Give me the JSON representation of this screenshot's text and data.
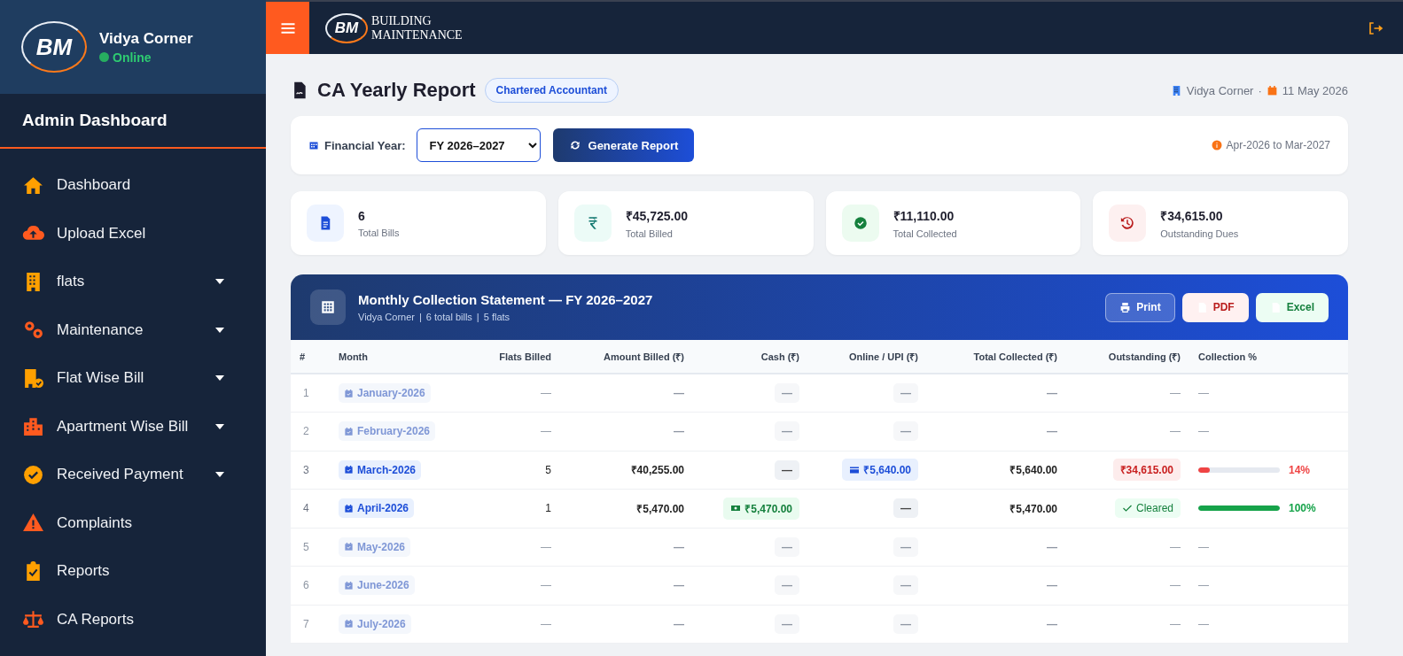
{
  "sidebar": {
    "logo": "BM",
    "user_name": "Vidya Corner",
    "status": "Online",
    "online": true,
    "section_title": "Admin Dashboard",
    "items": [
      {
        "label": "Dashboard",
        "kind": "home",
        "has_submenu": false
      },
      {
        "label": "Upload Excel",
        "kind": "upload",
        "has_submenu": false
      },
      {
        "label": "flats",
        "kind": "building",
        "has_submenu": true
      },
      {
        "label": "Maintenance",
        "kind": "gears",
        "has_submenu": true
      },
      {
        "label": "Flat Wise Bill",
        "kind": "bill",
        "has_submenu": true
      },
      {
        "label": "Apartment Wise Bill",
        "kind": "city",
        "has_submenu": true
      },
      {
        "label": "Received Payment",
        "kind": "payment",
        "has_submenu": true
      },
      {
        "label": "Complaints",
        "kind": "warning",
        "has_submenu": false
      },
      {
        "label": "Reports",
        "kind": "reports",
        "has_submenu": false
      },
      {
        "label": "CA Reports",
        "kind": "scale",
        "has_submenu": false
      }
    ]
  },
  "topbar": {
    "logo": "BM",
    "brand_line_1": "BUILDING",
    "brand_line_2": "MAINTENANCE"
  },
  "page": {
    "title": "CA Yearly Report",
    "badge": "Chartered Accountant",
    "building": "Vidya Corner",
    "separator": "·",
    "date": "11 May 2026"
  },
  "filter": {
    "label": "Financial Year:",
    "value": "FY 2026–2027",
    "button": "Generate Report",
    "range": "Apr-2026 to Mar-2027"
  },
  "stats": [
    {
      "kind": "bills",
      "value": "6",
      "label": "Total Bills"
    },
    {
      "kind": "billed",
      "value": "₹45,725.00",
      "label": "Total Billed"
    },
    {
      "kind": "collected",
      "value": "₹11,110.00",
      "label": "Total Collected"
    },
    {
      "kind": "dues",
      "value": "₹34,615.00",
      "label": "Outstanding Dues"
    }
  ],
  "statement": {
    "title": "Monthly Collection Statement — FY 2026–2027",
    "meta": [
      "Vidya Corner",
      "6 total bills",
      "5 flats"
    ],
    "meta_separator": "|",
    "buttons": [
      {
        "kind": "print",
        "label": "Print"
      },
      {
        "kind": "pdf",
        "label": "PDF"
      },
      {
        "kind": "excel",
        "label": "Excel"
      }
    ]
  },
  "table": {
    "columns": [
      "#",
      "Month",
      "Flats Billed",
      "Amount Billed (₹)",
      "Cash (₹)",
      "Online / UPI (₹)",
      "Total Collected (₹)",
      "Outstanding (₹)",
      "Collection %"
    ],
    "rows": [
      {
        "index": "1",
        "month": "January-2026",
        "active": false,
        "flats": "—",
        "billed": "—",
        "cash": {
          "kind": "none",
          "text": "—"
        },
        "online": {
          "kind": "none",
          "text": "—"
        },
        "collected": "—",
        "outstanding": {
          "kind": "none",
          "text": "—"
        },
        "collection": {
          "kind": "none",
          "text": "—"
        }
      },
      {
        "index": "2",
        "month": "February-2026",
        "active": false,
        "flats": "—",
        "billed": "—",
        "cash": {
          "kind": "none",
          "text": "—"
        },
        "online": {
          "kind": "none",
          "text": "—"
        },
        "collected": "—",
        "outstanding": {
          "kind": "none",
          "text": "—"
        },
        "collection": {
          "kind": "none",
          "text": "—"
        }
      },
      {
        "index": "3",
        "month": "March-2026",
        "active": true,
        "flats": "5",
        "billed": "₹40,255.00",
        "cash": {
          "kind": "none",
          "text": "—"
        },
        "online": {
          "kind": "online",
          "text": "₹5,640.00"
        },
        "collected": "₹5,640.00",
        "outstanding": {
          "kind": "due",
          "text": "₹34,615.00"
        },
        "collection": {
          "kind": "partial",
          "level": 0.14,
          "reading": "14%"
        }
      },
      {
        "index": "4",
        "month": "April-2026",
        "active": true,
        "flats": "1",
        "billed": "₹5,470.00",
        "cash": {
          "kind": "cash",
          "text": "₹5,470.00"
        },
        "online": {
          "kind": "none",
          "text": "—"
        },
        "collected": "₹5,470.00",
        "outstanding": {
          "kind": "cleared",
          "text": "Cleared"
        },
        "collection": {
          "kind": "full",
          "level": 1,
          "reading": "100%"
        }
      },
      {
        "index": "5",
        "month": "May-2026",
        "active": false,
        "flats": "—",
        "billed": "—",
        "cash": {
          "kind": "none",
          "text": "—"
        },
        "online": {
          "kind": "none",
          "text": "—"
        },
        "collected": "—",
        "outstanding": {
          "kind": "none",
          "text": "—"
        },
        "collection": {
          "kind": "none",
          "text": "—"
        }
      },
      {
        "index": "6",
        "month": "June-2026",
        "active": false,
        "flats": "—",
        "billed": "—",
        "cash": {
          "kind": "none",
          "text": "—"
        },
        "online": {
          "kind": "none",
          "text": "—"
        },
        "collected": "—",
        "outstanding": {
          "kind": "none",
          "text": "—"
        },
        "collection": {
          "kind": "none",
          "text": "—"
        }
      },
      {
        "index": "7",
        "month": "July-2026",
        "active": false,
        "flats": "—",
        "billed": "—",
        "cash": {
          "kind": "none",
          "text": "—"
        },
        "online": {
          "kind": "none",
          "text": "—"
        },
        "collected": "—",
        "outstanding": {
          "kind": "none",
          "text": "—"
        },
        "collection": {
          "kind": "none",
          "text": "—"
        }
      }
    ]
  }
}
